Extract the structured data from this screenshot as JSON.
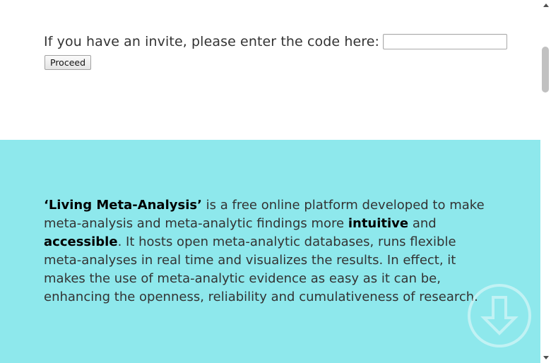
{
  "invite": {
    "label": "If you have an invite, please enter the code here:",
    "code_value": "",
    "proceed_label": "Proceed"
  },
  "about": {
    "term": "‘Living Meta-Analysis’",
    "text_1": " is a free online platform developed to make meta-analysis and meta-analytic findings more ",
    "emphasis_1": "intuitive",
    "text_2": " and ",
    "emphasis_2": "accessible",
    "text_3": ". It hosts open meta-analytic databases, runs flexible meta-analyses in real time and visualizes the results. In effect, it makes the use of meta-analytic evidence as easy as it can be, enhancing the openness, reliability and cumulativeness of research."
  },
  "icons": {
    "scroll_down": "arrow-down-circle-icon",
    "scroll_up": "triangle-up-icon",
    "scroll_down_arrow": "triangle-down-icon"
  },
  "colors": {
    "about_background": "#8ee8ec",
    "text": "#333333",
    "icon": "#ffffff"
  }
}
